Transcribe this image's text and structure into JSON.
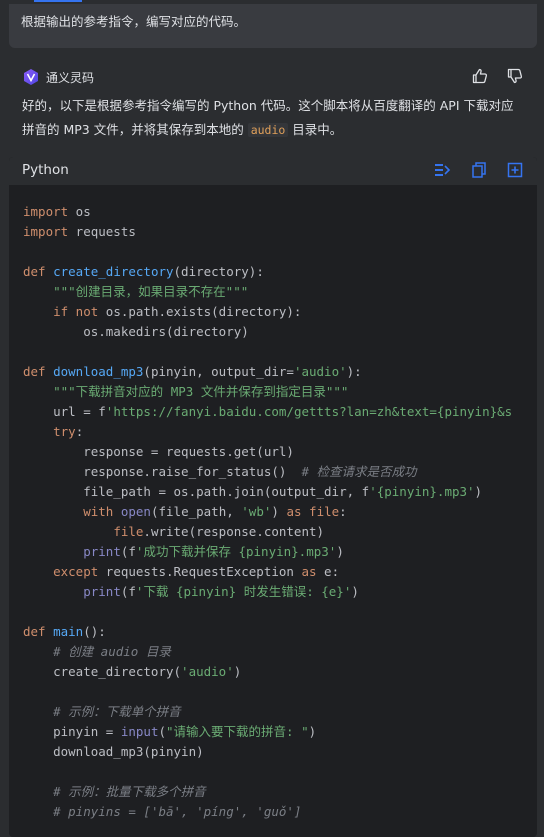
{
  "user_message": "根据输出的参考指令，编写对应的代码。",
  "assistant": {
    "name": "通义灵码",
    "intro_before": "好的，以下是根据参考指令编写的 Python 代码。这个脚本将从百度翻译的 API 下载对应拼音的 MP3 文件，并将其保存到本地的 ",
    "intro_code": "audio",
    "intro_after": " 目录中。",
    "thumbs_up_icon": "thumbs-up-icon",
    "thumbs_down_icon": "thumbs-down-icon"
  },
  "code_block": {
    "language": "Python",
    "toolbar_icons": [
      "insert-at-cursor-icon",
      "copy-icon",
      "new-file-icon"
    ],
    "lines": [
      [
        [
          "kw",
          "import"
        ],
        [
          "p",
          " os"
        ]
      ],
      [
        [
          "kw",
          "import"
        ],
        [
          "p",
          " requests"
        ]
      ],
      [],
      [
        [
          "kw",
          "def"
        ],
        [
          "p",
          " "
        ],
        [
          "fn",
          "create_directory"
        ],
        [
          "p",
          "(directory):"
        ]
      ],
      [
        [
          "p",
          "    "
        ],
        [
          "str",
          "\"\"\"创建目录，如果目录不存在\"\"\""
        ]
      ],
      [
        [
          "p",
          "    "
        ],
        [
          "kw",
          "if not"
        ],
        [
          "p",
          " os.path.exists(directory):"
        ]
      ],
      [
        [
          "p",
          "        os.makedirs(directory)"
        ]
      ],
      [],
      [
        [
          "kw",
          "def"
        ],
        [
          "p",
          " "
        ],
        [
          "fn",
          "download_mp3"
        ],
        [
          "p",
          "(pinyin, output_dir="
        ],
        [
          "str",
          "'audio'"
        ],
        [
          "p",
          "):"
        ]
      ],
      [
        [
          "p",
          "    "
        ],
        [
          "str",
          "\"\"\"下载拼音对应的 MP3 文件并保存到指定目录\"\"\""
        ]
      ],
      [
        [
          "p",
          "    url = f"
        ],
        [
          "str",
          "'https://fanyi.baidu.com/gettts?lan=zh&text={pinyin}&s"
        ]
      ],
      [
        [
          "p",
          "    "
        ],
        [
          "kw",
          "try"
        ],
        [
          "p",
          ":"
        ]
      ],
      [
        [
          "p",
          "        response = requests.get(url)"
        ]
      ],
      [
        [
          "p",
          "        response.raise_for_status()  "
        ],
        [
          "cmt",
          "# 检查请求是否成功"
        ]
      ],
      [
        [
          "p",
          "        file_path = os.path.join(output_dir, f"
        ],
        [
          "str",
          "'{pinyin}.mp3'"
        ],
        [
          "p",
          ")"
        ]
      ],
      [
        [
          "p",
          "        "
        ],
        [
          "kw",
          "with"
        ],
        [
          "p",
          " "
        ],
        [
          "bi",
          "open"
        ],
        [
          "p",
          "(file_path, "
        ],
        [
          "str",
          "'wb'"
        ],
        [
          "p",
          ") "
        ],
        [
          "kw",
          "as"
        ],
        [
          "p",
          " "
        ],
        [
          "kw",
          "file"
        ],
        [
          "p",
          ":"
        ]
      ],
      [
        [
          "p",
          "            "
        ],
        [
          "kw",
          "file"
        ],
        [
          "p",
          ".write(response.content)"
        ]
      ],
      [
        [
          "p",
          "        "
        ],
        [
          "bi",
          "print"
        ],
        [
          "p",
          "(f"
        ],
        [
          "str",
          "'成功下载并保存 {pinyin}.mp3'"
        ],
        [
          "p",
          ")"
        ]
      ],
      [
        [
          "p",
          "    "
        ],
        [
          "kw",
          "except"
        ],
        [
          "p",
          " requests.RequestException "
        ],
        [
          "kw",
          "as"
        ],
        [
          "p",
          " e:"
        ]
      ],
      [
        [
          "p",
          "        "
        ],
        [
          "bi",
          "print"
        ],
        [
          "p",
          "(f"
        ],
        [
          "str",
          "'下载 {pinyin} 时发生错误: {e}'"
        ],
        [
          "p",
          ")"
        ]
      ],
      [],
      [
        [
          "kw",
          "def"
        ],
        [
          "p",
          " "
        ],
        [
          "fn",
          "main"
        ],
        [
          "p",
          "():"
        ]
      ],
      [
        [
          "p",
          "    "
        ],
        [
          "cmt",
          "# 创建 audio 目录"
        ]
      ],
      [
        [
          "p",
          "    create_directory("
        ],
        [
          "str",
          "'audio'"
        ],
        [
          "p",
          ")"
        ]
      ],
      [],
      [
        [
          "p",
          "    "
        ],
        [
          "cmt",
          "# 示例：下载单个拼音"
        ]
      ],
      [
        [
          "p",
          "    pinyin = "
        ],
        [
          "bi",
          "input"
        ],
        [
          "p",
          "("
        ],
        [
          "str",
          "\"请输入要下载的拼音: \""
        ],
        [
          "p",
          ")"
        ]
      ],
      [
        [
          "p",
          "    download_mp3(pinyin)"
        ]
      ],
      [],
      [
        [
          "p",
          "    "
        ],
        [
          "cmt",
          "# 示例：批量下载多个拼音"
        ]
      ],
      [
        [
          "p",
          "    "
        ],
        [
          "cmt",
          "# pinyins = ['bā', 'píng', 'guǒ']"
        ]
      ]
    ]
  },
  "colors": {
    "background": "#2b2d30",
    "code_background": "#1e1f22",
    "keyword": "#cf8e6d",
    "function": "#56a8f5",
    "string": "#6aab73",
    "comment": "#7a7e85",
    "accent": "#3574f0"
  }
}
